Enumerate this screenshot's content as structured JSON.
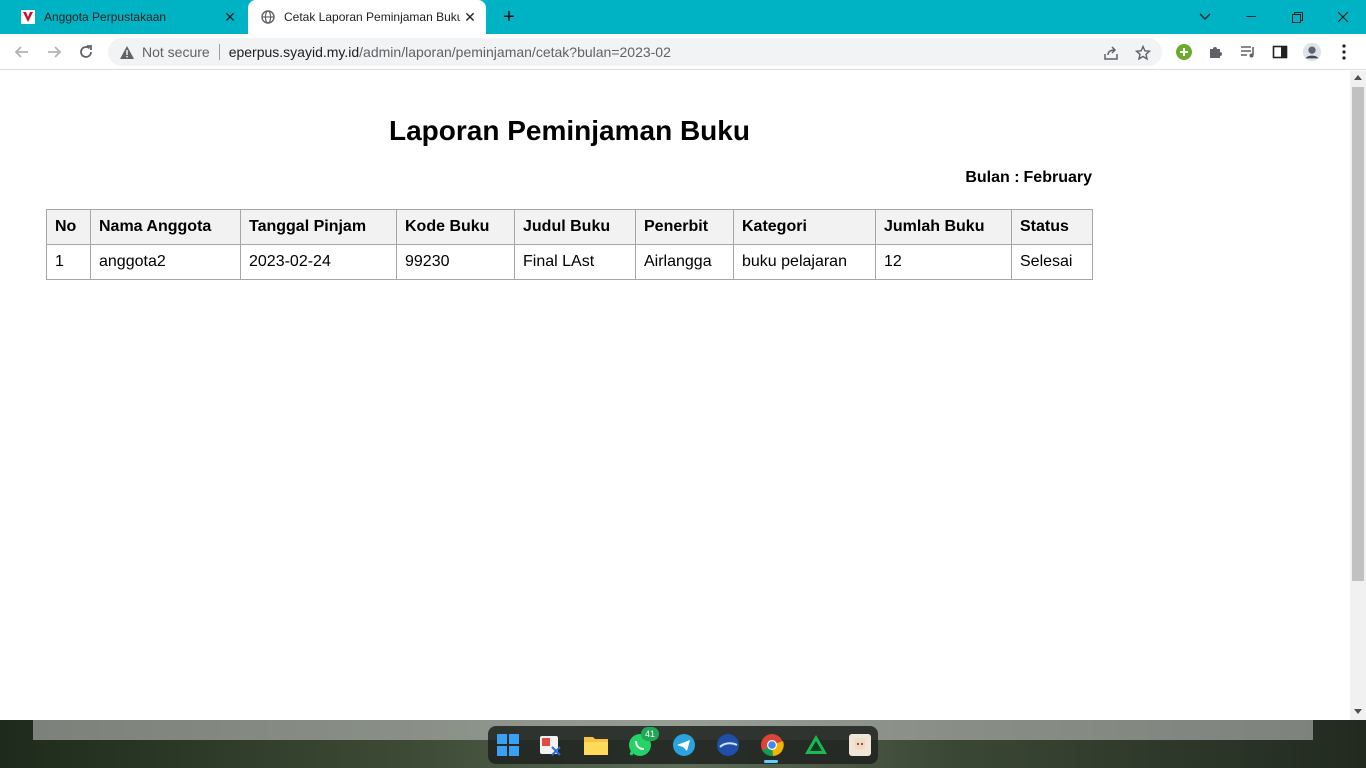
{
  "browser": {
    "tabs": [
      {
        "title": "Anggota Perpustakaan",
        "active": false
      },
      {
        "title": "Cetak Laporan Peminjaman Buku",
        "active": true
      }
    ],
    "new_tab": "+",
    "security_label": "Not secure",
    "url_host": "eperpus.syayid.my.id",
    "url_path": "/admin/laporan/peminjaman/cetak?bulan=2023-02"
  },
  "report": {
    "title": "Laporan Peminjaman Buku",
    "month_label": "Bulan :",
    "month_value": "February",
    "columns": [
      "No",
      "Nama Anggota",
      "Tanggal Pinjam",
      "Kode Buku",
      "Judul Buku",
      "Penerbit",
      "Kategori",
      "Jumlah Buku",
      "Status"
    ],
    "rows": [
      [
        "1",
        "anggota2",
        "2023-02-24",
        "99230",
        "Final LAst",
        "Airlangga",
        "buku pelajaran",
        "12",
        "Selesai"
      ]
    ]
  },
  "taskbar": {
    "whatsapp_badge": "41",
    "apps": [
      "start-icon",
      "snipping-tool-icon",
      "file-explorer-icon",
      "whatsapp-icon",
      "telegram-icon",
      "browser-globe-icon",
      "chrome-icon",
      "app-triangle-icon",
      "anime-app-icon"
    ]
  },
  "colors": {
    "tabstrip": "#00b3c4",
    "header_bg": "#f2f2f2",
    "border": "#a6a6a6"
  }
}
